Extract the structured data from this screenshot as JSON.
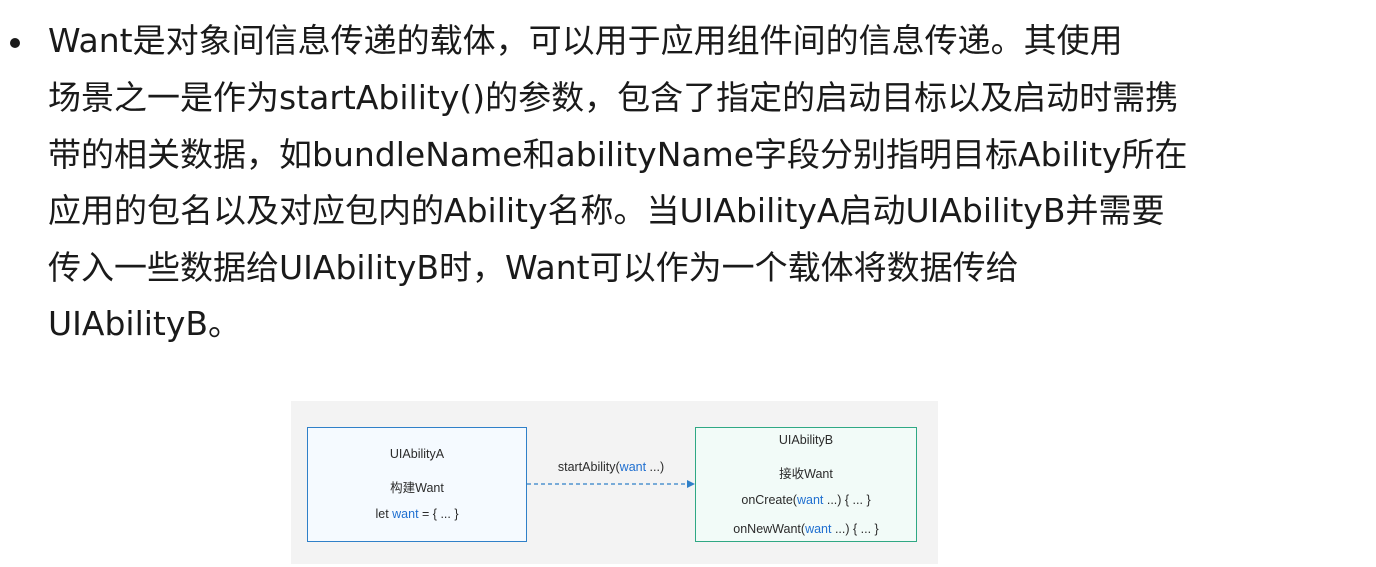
{
  "paragraph": {
    "lines": [
      "Want是对象间信息传递的载体，可以用于应用组件间的信息传递。其使用",
      "场景之一是作为startAbility()的参数，包含了指定的启动目标以及启动时需携",
      "带的相关数据，如bundleName和abilityName字段分别指明目标Ability所在",
      "应用的包名以及对应包内的Ability名称。当UIAbilityA启动UIAbilityB并需要",
      "传入一些数据给UIAbilityB时，Want可以作为一个载体将数据传给",
      "UIAbilityB。"
    ]
  },
  "figure": {
    "box_a": {
      "title": "UIAbilityA",
      "line2": "构建Want",
      "line3_pre": "let ",
      "line3_hl": "want",
      "line3_post": " = { ... }"
    },
    "arrow": {
      "label_pre": "startAbility(",
      "label_hl": "want",
      "label_post": " ...)"
    },
    "box_b": {
      "title": "UIAbilityB",
      "line2": "接收Want",
      "line3_pre": "onCreate(",
      "line3_hl": "want",
      "line3_post": " ...) { ... }",
      "line4_pre": "onNewWant(",
      "line4_hl": "want",
      "line4_post": " ...) { ... }"
    },
    "colors": {
      "box_a_border": "#2f80c8",
      "box_b_border": "#2fa884",
      "highlight": "#1f6fd0",
      "arrow": "#2f80c8"
    }
  }
}
